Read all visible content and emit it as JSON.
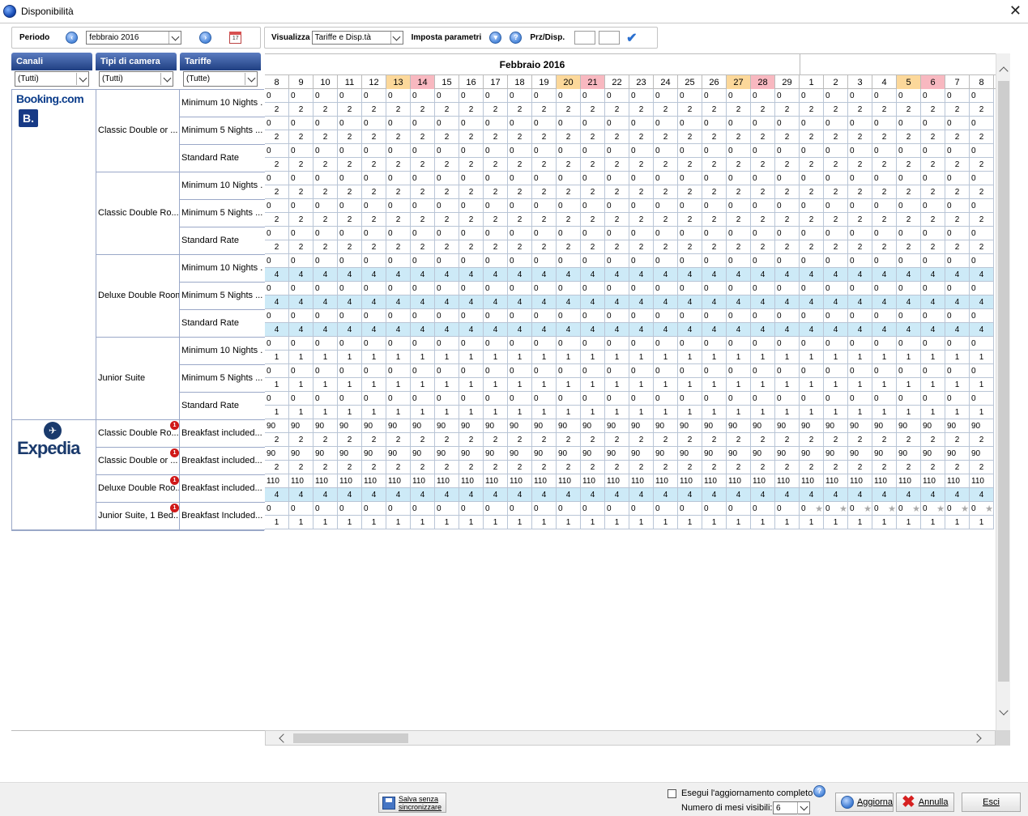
{
  "window": {
    "title": "Disponibilità"
  },
  "toolbar": {
    "periodo_label": "Periodo",
    "periodo_value": "febbraio 2016",
    "visualizza_label": "Visualizza",
    "visualizza_value": "Tariffe e Disp.tà",
    "imposta_label": "Imposta parametri",
    "prz_label": "Prz/Disp.",
    "prz_value": "",
    "disp_value": ""
  },
  "columns": {
    "canali": "Canali",
    "tipi": "Tipi di camera",
    "tariffe": "Tariffe",
    "filter_canali": "(Tutti)",
    "filter_tipi": "(Tutti)",
    "filter_tariffe": "(Tutte)"
  },
  "calendar": {
    "month_label": "Febbraio 2016",
    "days": [
      "8",
      "9",
      "10",
      "11",
      "12",
      "13",
      "14",
      "15",
      "16",
      "17",
      "18",
      "19",
      "20",
      "21",
      "22",
      "23",
      "24",
      "25",
      "26",
      "27",
      "28",
      "29",
      "1",
      "2",
      "3",
      "4",
      "5",
      "6",
      "7",
      "8"
    ],
    "day_classes": [
      "",
      "",
      "",
      "",
      "",
      "sat",
      "sun",
      "",
      "",
      "",
      "",
      "",
      "sat",
      "sun",
      "",
      "",
      "",
      "",
      "",
      "sat",
      "sun",
      "",
      "",
      "",
      "",
      "",
      "sat",
      "sun",
      "",
      ""
    ]
  },
  "colors": {
    "saturday": "#fcd89a",
    "sunday": "#f8b8c0",
    "avail_highlight": "#cdeaf7",
    "header_blue": "#1f3f82"
  },
  "channels": [
    {
      "name": "Booking.com",
      "logo": "B.",
      "rooms": [
        {
          "name": "Classic Double or ...",
          "rates": [
            {
              "name": "Minimum 10 Nights ...",
              "price": "0",
              "avail": "2"
            },
            {
              "name": "Minimum 5 Nights ...",
              "price": "0",
              "avail": "2"
            },
            {
              "name": "Standard Rate",
              "price": "0",
              "avail": "2"
            }
          ]
        },
        {
          "name": "Classic Double Ro...",
          "rates": [
            {
              "name": "Minimum 10 Nights ...",
              "price": "0",
              "avail": "2"
            },
            {
              "name": "Minimum 5 Nights ...",
              "price": "0",
              "avail": "2"
            },
            {
              "name": "Standard Rate",
              "price": "0",
              "avail": "2"
            }
          ]
        },
        {
          "name": "Deluxe Double Room",
          "rates": [
            {
              "name": "Minimum 10 Nights ...",
              "price": "0",
              "avail": "4",
              "hl": true
            },
            {
              "name": "Minimum 5 Nights ...",
              "price": "0",
              "avail": "4",
              "hl": true
            },
            {
              "name": "Standard Rate",
              "price": "0",
              "avail": "4",
              "hl": true
            }
          ]
        },
        {
          "name": "Junior Suite",
          "rates": [
            {
              "name": "Minimum 10 Nights ...",
              "price": "0",
              "avail": "1"
            },
            {
              "name": "Minimum 5 Nights ...",
              "price": "0",
              "avail": "1"
            },
            {
              "name": "Standard Rate",
              "price": "0",
              "avail": "1"
            }
          ]
        }
      ]
    },
    {
      "name": "Expedia",
      "rooms": [
        {
          "name": "Classic Double Ro...",
          "badge": "1",
          "rates": [
            {
              "name": "Breakfast included...",
              "price": "90",
              "avail": "2"
            }
          ]
        },
        {
          "name": "Classic Double or ...",
          "badge": "1",
          "rates": [
            {
              "name": "Breakfast included...",
              "price": "90",
              "avail": "2"
            }
          ]
        },
        {
          "name": "Deluxe Double Roo...",
          "badge": "1",
          "rates": [
            {
              "name": "Breakfast included...",
              "price": "110",
              "avail": "4",
              "hl": true
            }
          ]
        },
        {
          "name": "Junior Suite, 1 Bed...",
          "badge": "1",
          "rates": [
            {
              "name": "Breakfast Included...",
              "price": "0",
              "avail": "1",
              "stars": true
            }
          ]
        }
      ]
    }
  ],
  "footer": {
    "save_line1": "Salva senza",
    "save_line2": "sincronizzare",
    "full_update": "Esegui l'aggiornamento completo",
    "months_label": "Numero di mesi visibili:",
    "months_value": "6",
    "aggiorna": "Aggiorna",
    "annulla": "Annulla",
    "esci": "Esci"
  }
}
